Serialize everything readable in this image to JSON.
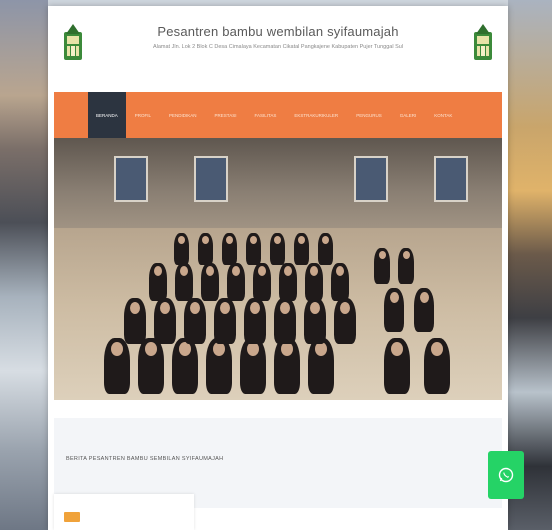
{
  "site": {
    "title": "Pesantren bambu wembilan syifaumajah",
    "address": "Alamat Jln. Lok 2 Blok C Desa Cimalaya Kecamatan Cikatal Pangkajene Kabupaten Pujer Tunggal Sul"
  },
  "nav": {
    "items": [
      {
        "label": "BERANDA",
        "active": true
      },
      {
        "label": "PROFIL",
        "active": false
      },
      {
        "label": "PENDIDIKAN",
        "active": false
      },
      {
        "label": "PRESTASI",
        "active": false
      },
      {
        "label": "FASILITAS",
        "active": false
      },
      {
        "label": "EKSTRAKURIKULER",
        "active": false
      },
      {
        "label": "PENGURUS",
        "active": false
      },
      {
        "label": "GALERI",
        "active": false
      },
      {
        "label": "KONTAK",
        "active": false
      }
    ]
  },
  "news": {
    "section_title": "BERITA PESANTREN BAMBU SEMBILAN SYIFAUMAJAH"
  },
  "colors": {
    "nav_bg": "#ef7d43",
    "nav_active": "#2c3440",
    "whatsapp": "#25d366",
    "badge": "#f0a23a"
  },
  "icons": {
    "logo": "pesantren-crest-icon",
    "floating": "whatsapp-icon"
  }
}
